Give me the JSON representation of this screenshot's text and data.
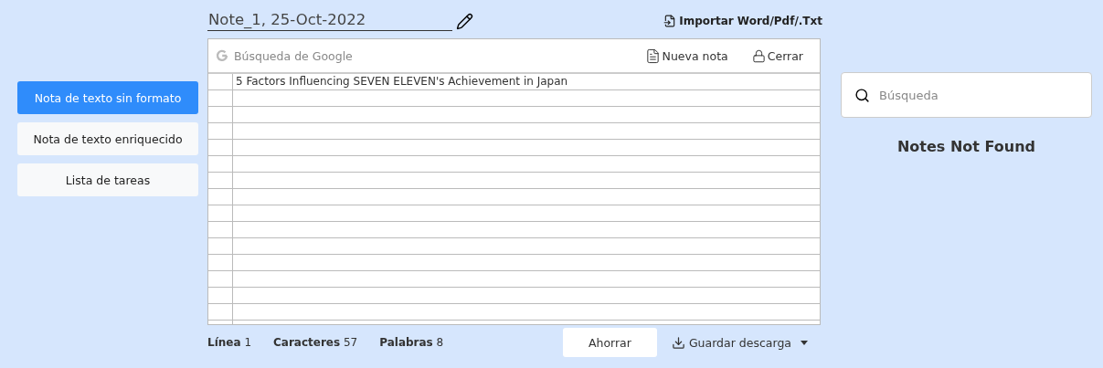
{
  "note_types": [
    {
      "label": "Nota de texto sin formato",
      "selected": true
    },
    {
      "label": "Nota de texto enriquecido",
      "selected": false
    },
    {
      "label": "Lista de tareas",
      "selected": false
    }
  ],
  "note_title": "Note_1, 25-Oct-2022",
  "import_link": "Importar Word/Pdf/.Txt",
  "editor": {
    "search": {
      "placeholder": "Búsqueda de Google"
    },
    "new_note": "Nueva nota",
    "close": "Cerrar",
    "lines": [
      "5 Factors Influencing SEVEN ELEVEN's Achievement in Japan"
    ]
  },
  "stats": [
    {
      "label": "Línea",
      "value": "1"
    },
    {
      "label": "Caracteres",
      "value": "57"
    },
    {
      "label": "Palabras",
      "value": "8"
    }
  ],
  "save_button": "Ahorrar",
  "download_button": "Guardar descarga",
  "notes_search": {
    "placeholder": "Búsqueda"
  },
  "empty_message": "Notes Not Found"
}
